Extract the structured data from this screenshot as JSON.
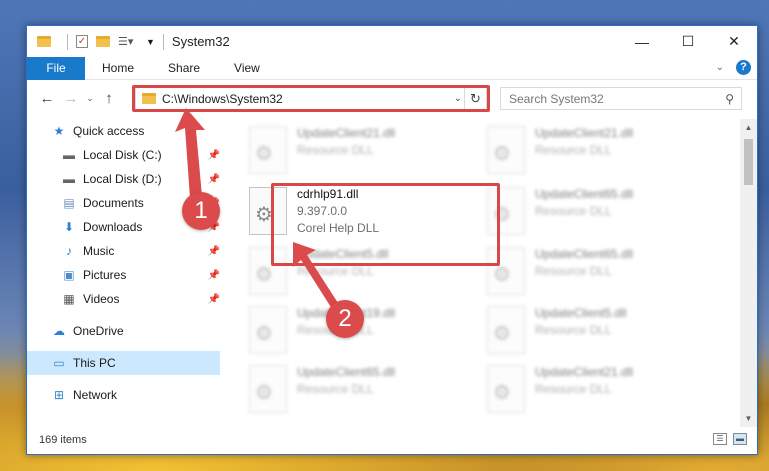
{
  "window": {
    "title": "System32"
  },
  "ribbon": {
    "file": "File",
    "tabs": [
      "Home",
      "Share",
      "View"
    ],
    "help": "?"
  },
  "address": {
    "path": "C:\\Windows\\System32"
  },
  "search": {
    "placeholder": "Search System32"
  },
  "sidebar": {
    "items": [
      {
        "label": "Quick access",
        "icon": "star-icon"
      },
      {
        "label": "Local Disk (C:)",
        "icon": "drive-icon"
      },
      {
        "label": "Local Disk (D:)",
        "icon": "drive-icon"
      },
      {
        "label": "Documents",
        "icon": "documents-icon"
      },
      {
        "label": "Downloads",
        "icon": "download-icon"
      },
      {
        "label": "Music",
        "icon": "music-icon"
      },
      {
        "label": "Pictures",
        "icon": "pictures-icon"
      },
      {
        "label": "Videos",
        "icon": "videos-icon"
      },
      {
        "label": "OneDrive",
        "icon": "cloud-icon"
      },
      {
        "label": "This PC",
        "icon": "computer-icon"
      },
      {
        "label": "Network",
        "icon": "network-icon"
      }
    ]
  },
  "files": {
    "highlighted": {
      "name": "cdrhlp91.dll",
      "version": "9.397.0.0",
      "desc": "Corel Help DLL"
    },
    "blurred": [
      {
        "name": "UpdateClient21.dll",
        "desc": "Resource DLL"
      },
      {
        "name": "UpdateClient21.dll",
        "desc": "Resource DLL"
      },
      {
        "name": "UpdateClient65.dll",
        "desc": "Resource DLL"
      },
      {
        "name": "UpdateClient5.dll",
        "desc": "Resource DLL"
      },
      {
        "name": "UpdateClient65.dll",
        "desc": "Resource DLL"
      },
      {
        "name": "UpdateClient19.dll",
        "desc": "Resource DLL"
      },
      {
        "name": "UpdateClient5.dll",
        "desc": "Resource DLL"
      },
      {
        "name": "UpdateClient65.dll",
        "desc": "Resource DLL"
      },
      {
        "name": "UpdateClient21.dll",
        "desc": "Resource DLL"
      }
    ]
  },
  "status": {
    "count": "169 items"
  },
  "badges": {
    "one": "1",
    "two": "2"
  },
  "colors": {
    "accent": "#1979ca",
    "highlight": "#d94848"
  }
}
